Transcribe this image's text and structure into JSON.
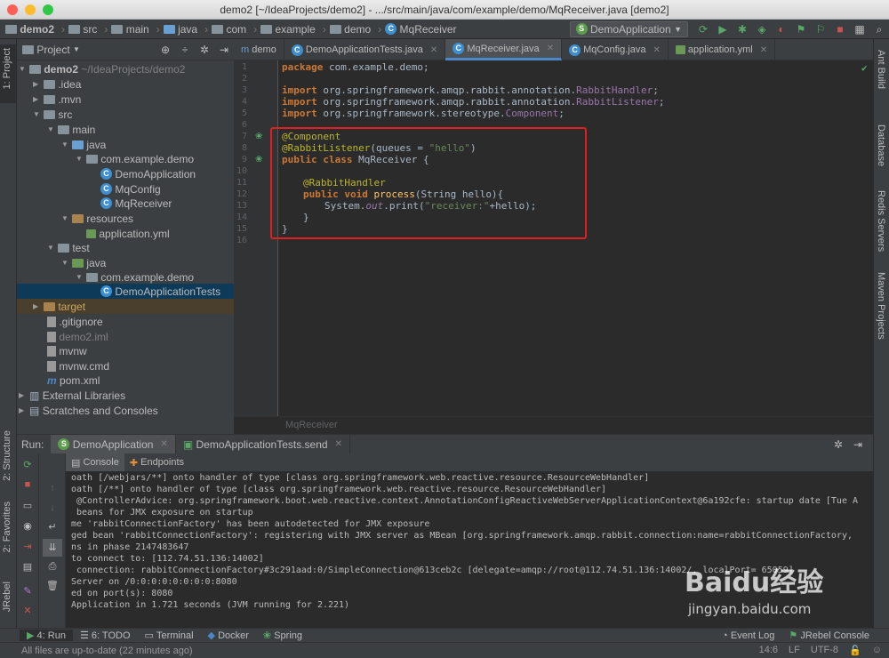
{
  "window": {
    "title": "demo2 [~/IdeaProjects/demo2] - .../src/main/java/com/example/demo/MqReceiver.java [demo2]"
  },
  "breadcrumbs": [
    "demo2",
    "src",
    "main",
    "java",
    "com",
    "example",
    "demo",
    "MqReceiver"
  ],
  "run_config": "DemoApplication",
  "left_strip": {
    "project": "1: Project",
    "structure": "2: Structure",
    "favorites": "2: Favorites",
    "jrebel": "JRebel"
  },
  "right_strip": {
    "ant": "Ant Build",
    "database": "Database",
    "redis": "Redis Servers",
    "maven": "Maven Projects"
  },
  "project_panel": {
    "title": "Project"
  },
  "tree": [
    {
      "label": "demo2",
      "extra": "~/IdeaProjects/demo2",
      "icon": "folder-icon"
    },
    {
      "label": ".idea",
      "icon": "folder-icon"
    },
    {
      "label": ".mvn",
      "icon": "folder-icon"
    },
    {
      "label": "src",
      "icon": "folder-icon"
    },
    {
      "label": "main",
      "icon": "folder-icon"
    },
    {
      "label": "java",
      "icon": "folder-icon"
    },
    {
      "label": "com.example.demo",
      "icon": "package-icon"
    },
    {
      "label": "DemoApplication",
      "icon": "spring-class-icon"
    },
    {
      "label": "MqConfig",
      "icon": "class-icon"
    },
    {
      "label": "MqReceiver",
      "icon": "class-icon"
    },
    {
      "label": "resources",
      "icon": "folder-icon"
    },
    {
      "label": "application.yml",
      "icon": "yml-icon"
    },
    {
      "label": "test",
      "icon": "folder-icon"
    },
    {
      "label": "java",
      "icon": "folder-icon"
    },
    {
      "label": "com.example.demo",
      "icon": "package-icon"
    },
    {
      "label": "DemoApplicationTests",
      "icon": "test-class-icon"
    },
    {
      "label": "target",
      "icon": "folder-icon"
    },
    {
      "label": ".gitignore",
      "icon": "file-icon"
    },
    {
      "label": "demo2.iml",
      "icon": "iml-icon"
    },
    {
      "label": "mvnw",
      "icon": "file-icon"
    },
    {
      "label": "mvnw.cmd",
      "icon": "file-icon"
    },
    {
      "label": "pom.xml",
      "icon": "maven-icon"
    },
    {
      "label": "External Libraries",
      "icon": "library-icon"
    },
    {
      "label": "Scratches and Consoles",
      "icon": "scratch-icon"
    }
  ],
  "editor_tabs": [
    "demo",
    "DemoApplicationTests.java",
    "MqReceiver.java",
    "MqConfig.java",
    "application.yml"
  ],
  "line_numbers": [
    "1",
    "2",
    "3",
    "4",
    "5",
    "6",
    "7",
    "8",
    "9",
    "10",
    "11",
    "12",
    "13",
    "14",
    "15",
    "16"
  ],
  "code": {
    "l1_kw": "package",
    "l1_rest": " com.example.demo;",
    "l3_kw": "import",
    "l3_rest": " org.springframework.amqp.rabbit.annotation.",
    "l3_cls": "RabbitHandler",
    "l3_end": ";",
    "l4_kw": "import",
    "l4_rest": " org.springframework.amqp.rabbit.annotation.",
    "l4_cls": "RabbitListener",
    "l4_end": ";",
    "l5_kw": "import",
    "l5_rest": " org.springframework.stereotype.",
    "l5_cls": "Component",
    "l5_end": ";",
    "l7": "@Component",
    "l8_ann": "@RabbitListener",
    "l8_mid": "(queues = ",
    "l8_str": "\"hello\"",
    "l8_end": ")",
    "l9_kw": "public class",
    "l9_rest": " MqReceiver {",
    "l11": "@RabbitHandler",
    "l12_kw": "public void",
    "l12_fn": " process",
    "l12_rest": "(String hello){",
    "l13_a": "System.",
    "l13_b": "out",
    "l13_c": ".print(",
    "l13_str": "\"receiver:\"",
    "l13_d": "+hello);",
    "l14": "}",
    "l15": "}"
  },
  "editor_breadcrumb": "MqReceiver",
  "run_panel": {
    "label": "Run:",
    "tabs": [
      "DemoApplication",
      "DemoApplicationTests.send"
    ],
    "subtabs": [
      "Console",
      "Endpoints"
    ]
  },
  "console_lines": [
    "oath [/webjars/**] onto handler of type [class org.springframework.web.reactive.resource.ResourceWebHandler]",
    "oath [/**] onto handler of type [class org.springframework.web.reactive.resource.ResourceWebHandler]",
    " @ControllerAdvice: org.springframework.boot.web.reactive.context.AnnotationConfigReactiveWebServerApplicationContext@6a192cfe: startup date [Tue A",
    " beans for JMX exposure on startup",
    "me 'rabbitConnectionFactory' has been autodetected for JMX exposure",
    "ged bean 'rabbitConnectionFactory': registering with JMX server as MBean [org.springframework.amqp.rabbit.connection:name=rabbitConnectionFactory,",
    "ns in phase 2147483647",
    "to connect to: [112.74.51.136:14002]",
    " connection: rabbitConnectionFactory#3c291aad:0/SimpleConnection@613ceb2c [delegate=amqp://root@112.74.51.136:14002/, localPort= 65059]",
    "Server on /0:0:0:0:0:0:0:0:8080",
    "ed on port(s): 8080",
    "Application in 1.721 seconds (JVM running for 2.221)"
  ],
  "bottom_tabs": [
    "4: Run",
    "6: TODO",
    "Terminal",
    "Docker",
    "Spring",
    "Event Log",
    "JRebel Console"
  ],
  "status": {
    "message": "All files are up-to-date (22 minutes ago)",
    "position": "14:6",
    "line_sep": "LF",
    "encoding": "UTF-8"
  },
  "watermark": {
    "brand": "Baidu经验",
    "url": "jingyan.baidu.com"
  }
}
